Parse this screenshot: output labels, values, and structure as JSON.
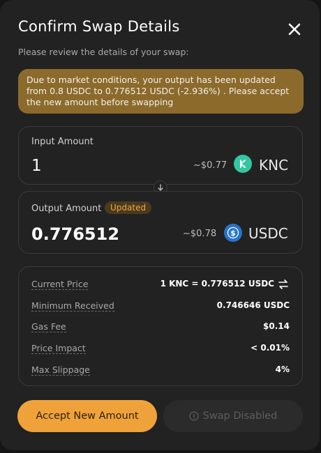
{
  "modal": {
    "title": "Confirm Swap Details",
    "subtitle": "Please review the details of your swap:",
    "notice": "Due to market conditions, your output has been updated from 0.8 USDC to 0.776512 USDC (-2.936%) . Please accept the new amount before swapping"
  },
  "input": {
    "label": "Input Amount",
    "amount": "1",
    "usd": "~$0.77",
    "token": "KNC",
    "icon": "knc-token-icon",
    "icon_color": "#33c7a0"
  },
  "output": {
    "label": "Output Amount",
    "badge": "Updated",
    "amount": "0.776512",
    "usd": "~$0.78",
    "token": "USDC",
    "icon": "usdc-token-icon",
    "icon_color": "#2775ca"
  },
  "details": {
    "current_price": {
      "label": "Current Price",
      "value": "1 KNC = 0.776512 USDC"
    },
    "minimum_received": {
      "label": "Minimum Received",
      "value": "0.746646 USDC"
    },
    "gas_fee": {
      "label": "Gas Fee",
      "value": "$0.14"
    },
    "price_impact": {
      "label": "Price Impact",
      "value": "< 0.01%"
    },
    "max_slippage": {
      "label": "Max Slippage",
      "value": "4%"
    }
  },
  "buttons": {
    "accept": "Accept New Amount",
    "swap_disabled": "Swap Disabled"
  },
  "colors": {
    "accent": "#f0a23a",
    "notice_bg": "#8b6a2c",
    "panel_bg": "#222222"
  }
}
